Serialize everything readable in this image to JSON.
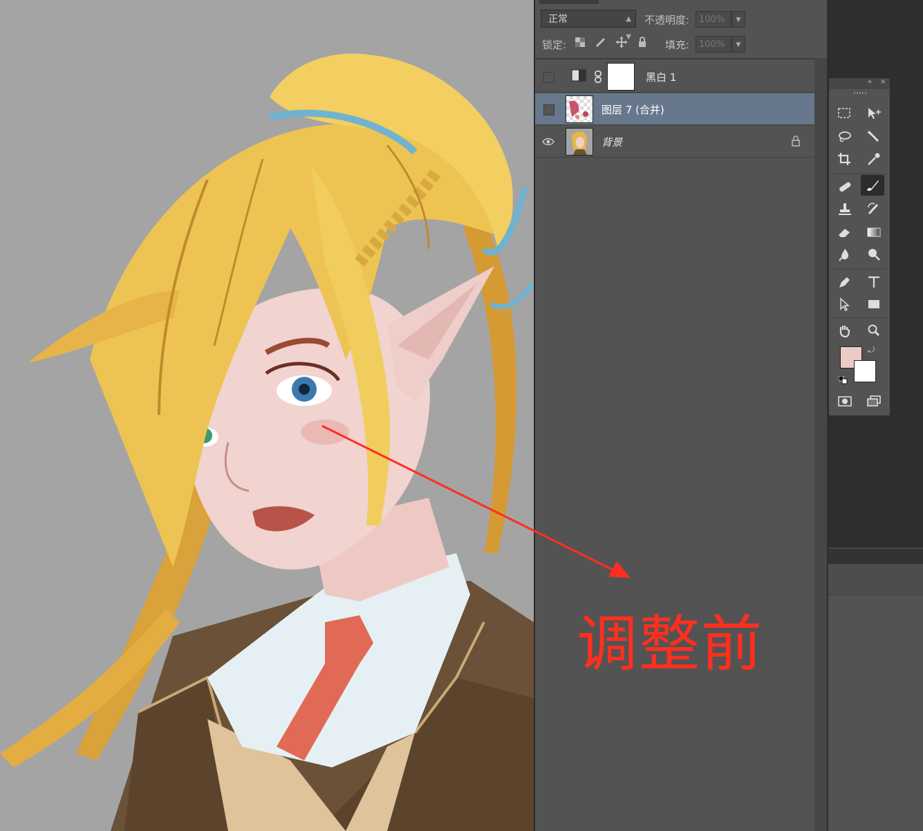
{
  "canvas": {
    "background_color": "#a4a4a4",
    "artwork": "portrait illustration"
  },
  "layers_panel": {
    "blend_mode": "正常",
    "opacity_label": "不透明度:",
    "opacity_value": "100%",
    "lock_label": "锁定:",
    "fill_label": "填充:",
    "fill_value": "100%",
    "layers": [
      {
        "name": "黑白 1",
        "visible": false,
        "selected": false,
        "type": "adjustment"
      },
      {
        "name": "图层 7 (合并)",
        "visible": false,
        "selected": true,
        "type": "pixel"
      },
      {
        "name": "背景",
        "visible": true,
        "selected": false,
        "type": "background",
        "locked": true
      }
    ]
  },
  "toolbox": {
    "foreground_color": "#eccac5",
    "background_color": "#ffffff",
    "tools": [
      "marquee-icon",
      "move-icon",
      "lasso-icon",
      "magic-wand-icon",
      "crop-icon",
      "eyedropper-icon",
      "healing-brush-icon",
      "brush-icon",
      "stamp-icon",
      "history-brush-icon",
      "eraser-icon",
      "gradient-icon",
      "blur-icon",
      "dodge-icon",
      "pen-icon",
      "type-icon",
      "path-select-icon",
      "rectangle-icon",
      "hand-icon",
      "zoom-icon",
      "quick-mask-icon",
      "screen-mode-icon"
    ]
  },
  "annotation": {
    "label": "调整前",
    "color": "#ff2f1f"
  }
}
